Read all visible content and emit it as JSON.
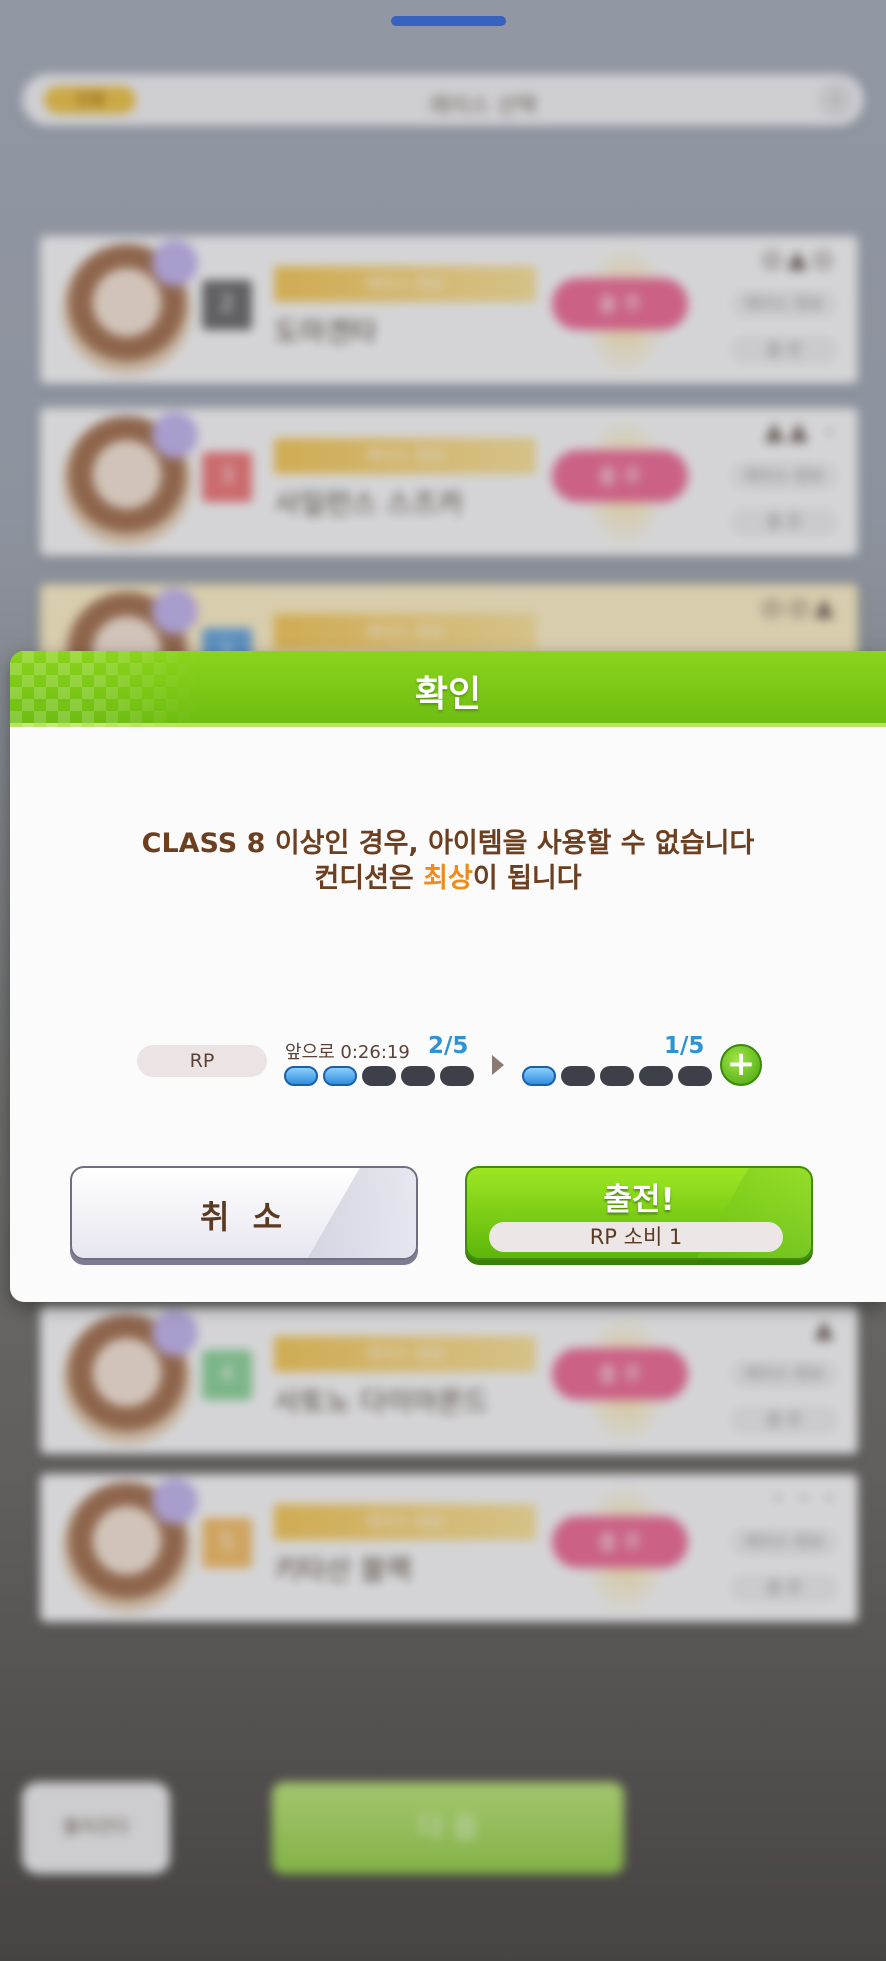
{
  "background": {
    "header_badge": "진행",
    "header_title": "레이스 선택",
    "cards": [
      {
        "grade": "2",
        "grade_color": "#6e6e6e",
        "banner": "레이스 정보",
        "name": "도마겐타",
        "button": "출 주",
        "label1": "레이스 정보",
        "label2": "출 전",
        "icons": "◎▲◎"
      },
      {
        "grade": "3",
        "grade_color": "#f07a7a",
        "banner": "레이스 정보",
        "name": "사일런스 스즈카",
        "button": "출 주",
        "label1": "레이스 정보",
        "label2": "출 전",
        "icons": "▲▲ -"
      },
      {
        "grade": "1",
        "grade_color": "#6aa8e0",
        "banner": "레이스 정보",
        "name": "",
        "button": "",
        "label1": "",
        "label2": "",
        "icons": "◎◎▲"
      },
      {
        "grade": "4",
        "grade_color": "#8ed59a",
        "banner": "레이스 정보",
        "name": "사토노 다이아몬드",
        "button": "출 주",
        "label1": "레이스 정보",
        "label2": "출 전",
        "icons": "▲"
      },
      {
        "grade": "5",
        "grade_color": "#f6c06a",
        "banner": "레이스 정보",
        "name": "키타산 블랙",
        "button": "출 주",
        "label1": "레이스 정보",
        "label2": "출 전",
        "icons": "- - -"
      }
    ],
    "back_label": "돌아간다",
    "next_label": "다 음"
  },
  "dialog": {
    "title": "확인",
    "message_line1": "CLASS 8 이상인 경우, 아이템을 사용할 수 없습니다",
    "message_line2_prefix": "컨디션은 ",
    "message_line2_highlight": "최상",
    "message_line2_suffix": "이 됩니다",
    "rp_label": "RP",
    "rp_timer": "앞으로 0:26:19",
    "rp_before": "2/5",
    "rp_before_filled": 2,
    "rp_after": "1/5",
    "rp_after_filled": 1,
    "rp_total": 5,
    "cancel_label": "취 소",
    "confirm_label": "출전!",
    "confirm_sub": "RP 소비 1",
    "accent_green": "#6fbd12",
    "highlight_orange": "#f08a1c"
  }
}
